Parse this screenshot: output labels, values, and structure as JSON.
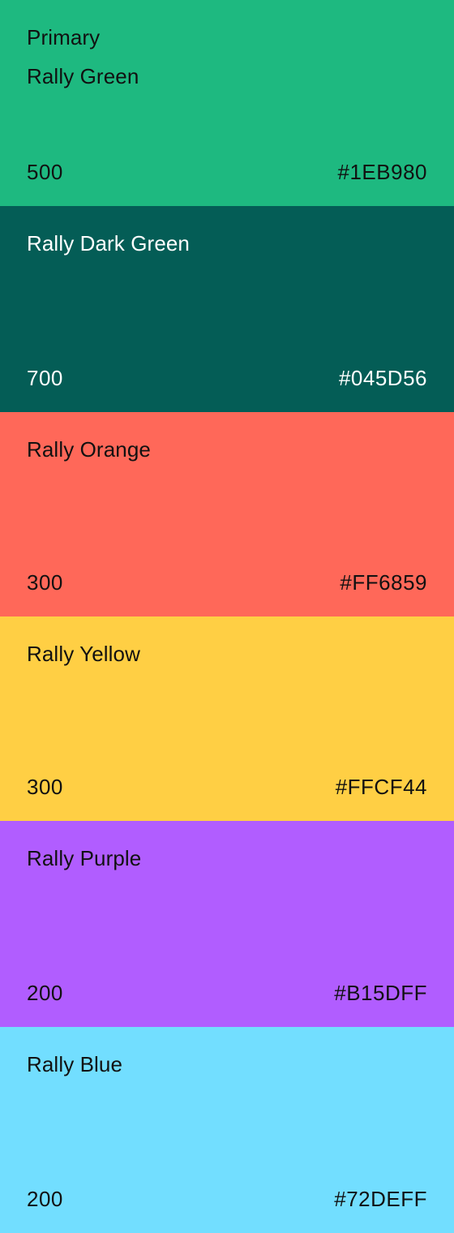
{
  "swatches": [
    {
      "caption": "Primary",
      "name": "Rally Green",
      "weight": "500",
      "hex": "#1EB980",
      "background": "#1EB980",
      "text_color": "#111111"
    },
    {
      "caption": "",
      "name": "Rally Dark Green",
      "weight": "700",
      "hex": "#045D56",
      "background": "#045D56",
      "text_color": "#FFFFFF"
    },
    {
      "caption": "",
      "name": "Rally Orange",
      "weight": "300",
      "hex": "#FF6859",
      "background": "#FF6859",
      "text_color": "#111111"
    },
    {
      "caption": "",
      "name": "Rally Yellow",
      "weight": "300",
      "hex": "#FFCF44",
      "background": "#FFCF44",
      "text_color": "#111111"
    },
    {
      "caption": "",
      "name": "Rally Purple",
      "weight": "200",
      "hex": "#B15DFF",
      "background": "#B15DFF",
      "text_color": "#111111"
    },
    {
      "caption": "",
      "name": "Rally Blue",
      "weight": "200",
      "hex": "#72DEFF",
      "background": "#72DEFF",
      "text_color": "#111111"
    }
  ]
}
